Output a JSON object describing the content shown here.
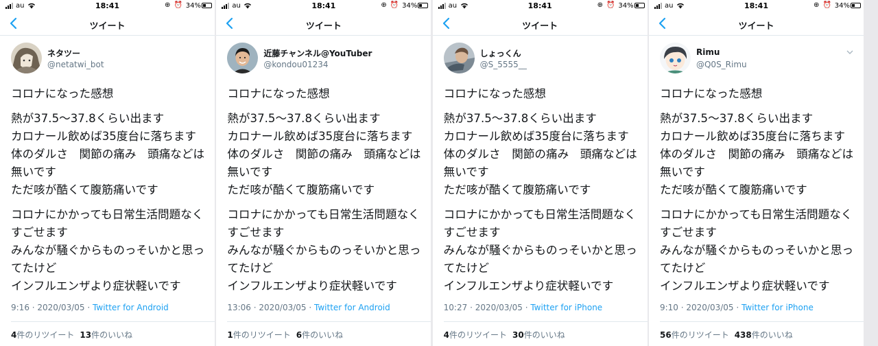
{
  "colors": {
    "link": "#1da1f2",
    "secondary": "#657786",
    "text": "#14171a"
  },
  "panels": [
    {
      "status": {
        "carrier": "au",
        "time": "18:41",
        "battery": "34%"
      },
      "nav": {
        "title": "ツイート",
        "back_icon": "chevron-left-icon"
      },
      "author": {
        "name": "ネタツー",
        "handle": "@netatwi_bot"
      },
      "tweet": {
        "l1": "コロナになった感想",
        "l2": "熱が37.5〜37.8くらい出ます",
        "l3": "カロナール飲めば35度台に落ちます",
        "l4": "体のダルさ　関節の痛み　頭痛などは",
        "l5": "無いです",
        "l6": "ただ咳が酷くて腹筋痛いです",
        "l7": "コロナにかかっても日常生活問題なく",
        "l8": "すごせます",
        "l9": "みんなが騒ぐからものっそいかと思っ",
        "l10": "てたけど",
        "l11": "インフルエンザより症状軽いです"
      },
      "meta": {
        "time": "9:16",
        "sep": " · ",
        "date": "2020/03/05",
        "source": "Twitter for Android"
      },
      "stats": {
        "retweets": "4",
        "retweets_label": "件のリツイート",
        "likes": "13",
        "likes_label": "件のいいね"
      }
    },
    {
      "status": {
        "carrier": "au",
        "time": "18:41",
        "battery": "34%"
      },
      "nav": {
        "title": "ツイート",
        "back_icon": "chevron-left-icon"
      },
      "author": {
        "name": "近藤チャンネル@YouTuber",
        "handle": "@kondou01234"
      },
      "tweet": {
        "l1": "コロナになった感想",
        "l2": "熱が37.5〜37.8くらい出ます",
        "l3": "カロナール飲めば35度台に落ちます",
        "l4": "体のダルさ　関節の痛み　頭痛などは",
        "l5": "無いです",
        "l6": "ただ咳が酷くて腹筋痛いです",
        "l7": "コロナにかかっても日常生活問題なく",
        "l8": "すごせます",
        "l9": "みんなが騒ぐからものっそいかと思っ",
        "l10": "てたけど",
        "l11": "インフルエンザより症状軽いです"
      },
      "meta": {
        "time": "13:06",
        "sep": " · ",
        "date": "2020/03/05",
        "source": "Twitter for Android"
      },
      "stats": {
        "retweets": "1",
        "retweets_label": "件のリツイート",
        "likes": "6",
        "likes_label": "件のいいね"
      }
    },
    {
      "status": {
        "carrier": "au",
        "time": "18:41",
        "battery": "34%"
      },
      "nav": {
        "title": "ツイート",
        "back_icon": "chevron-left-icon"
      },
      "author": {
        "name": "しょっくん",
        "handle": "@S_5555__"
      },
      "tweet": {
        "l1": "コロナになった感想",
        "l2": "熱が37.5〜37.8くらい出ます",
        "l3": "カロナール飲めば35度台に落ちます",
        "l4": "体のダルさ　関節の痛み　頭痛などは",
        "l5": "無いです",
        "l6": "ただ咳が酷くて腹筋痛いです",
        "l7": "コロナにかかっても日常生活問題なく",
        "l8": "すごせます",
        "l9": "みんなが騒ぐからものっそいかと思っ",
        "l10": "てたけど",
        "l11": "インフルエンザより症状軽いです"
      },
      "meta": {
        "time": "10:27",
        "sep": " · ",
        "date": "2020/03/05",
        "source": "Twitter for iPhone"
      },
      "stats": {
        "retweets": "4",
        "retweets_label": "件のリツイート",
        "likes": "30",
        "likes_label": "件のいいね"
      }
    },
    {
      "status": {
        "carrier": "au",
        "time": "18:41",
        "battery": "34%"
      },
      "nav": {
        "title": "ツイート",
        "back_icon": "chevron-left-icon"
      },
      "author": {
        "name": "Rimu",
        "handle": "@Q0S_Rimu"
      },
      "tweet": {
        "l1": "コロナになった感想",
        "l2": "熱が37.5〜37.8くらい出ます",
        "l3": "カロナール飲めば35度台に落ちます",
        "l4": "体のダルさ　関節の痛み　頭痛などは",
        "l5": "無いです",
        "l6": "ただ咳が酷くて腹筋痛いです",
        "l7": "コロナにかかっても日常生活問題なく",
        "l8": "すごせます",
        "l9": "みんなが騒ぐからものっそいかと思っ",
        "l10": "てたけど",
        "l11": "インフルエンザより症状軽いです"
      },
      "meta": {
        "time": "9:10",
        "sep": " · ",
        "date": "2020/03/05",
        "source": "Twitter for iPhone"
      },
      "stats": {
        "retweets": "56",
        "retweets_label": "件のリツイート",
        "likes": "438",
        "likes_label": "件のいいね"
      }
    }
  ]
}
